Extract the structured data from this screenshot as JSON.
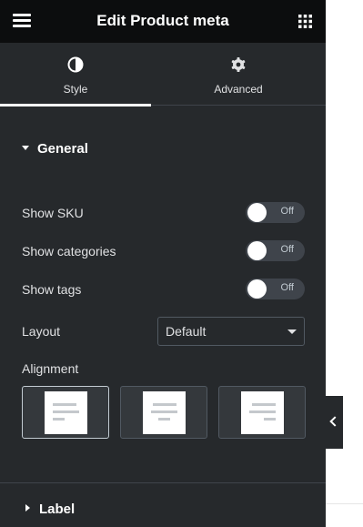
{
  "header": {
    "title": "Edit Product meta"
  },
  "tabs": [
    {
      "label": "Style",
      "icon": "adjust-icon",
      "active": true
    },
    {
      "label": "Advanced",
      "icon": "gear-icon",
      "active": false
    }
  ],
  "general": {
    "title": "General",
    "show_sku": {
      "label": "Show SKU",
      "state": "Off"
    },
    "show_categories": {
      "label": "Show categories",
      "state": "Off"
    },
    "show_tags": {
      "label": "Show tags",
      "state": "Off"
    },
    "layout": {
      "label": "Layout",
      "value": "Default"
    },
    "alignment": {
      "label": "Alignment",
      "options": [
        "left",
        "center",
        "right"
      ],
      "selected": "left"
    }
  },
  "label_section": {
    "title": "Label"
  },
  "colors": {
    "panel_bg": "#26292c",
    "header_bg": "#0c0d0e",
    "text": "#e0e1e3",
    "accent": "#ffffff"
  }
}
